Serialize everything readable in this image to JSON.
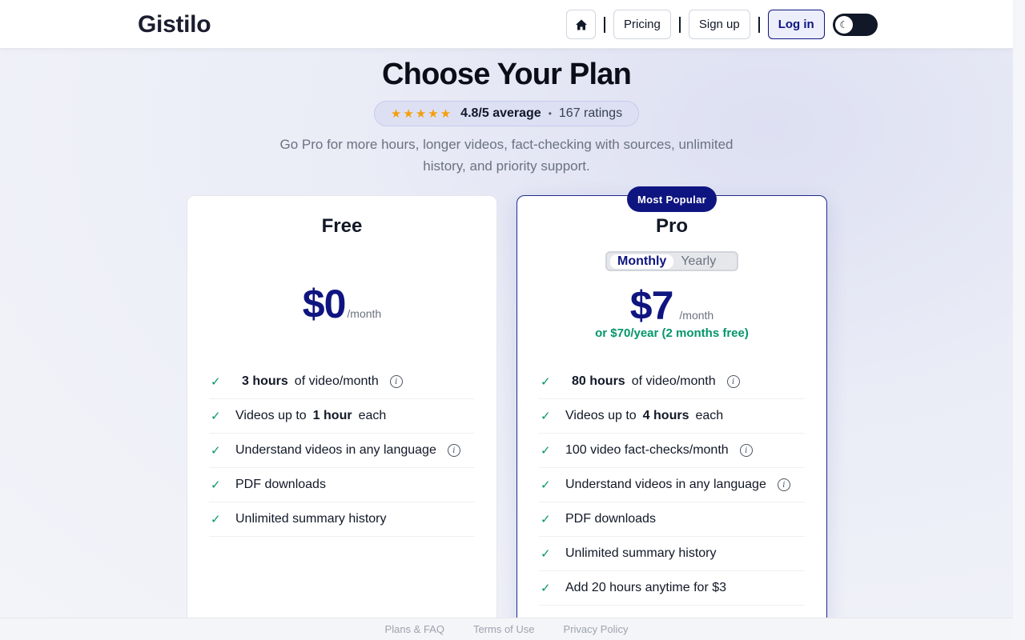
{
  "nav": {
    "logo": "Gistilo",
    "home_icon": "home-icon",
    "pricing_label": "Pricing",
    "signup_label": "Sign up",
    "login_label": "Log in",
    "theme_toggle_icon": "☾"
  },
  "hero": {
    "title": "Choose Your Plan",
    "stars": "★★★★★",
    "rating_text": "4.8/5 average",
    "separator": "•",
    "ratings_count": "167 ratings",
    "subtitle": "Go Pro for more hours, longer videos, fact-checking with sources, unlimited history, and priority support."
  },
  "plans": {
    "free": {
      "name": "Free",
      "price": "$0",
      "period": "/month",
      "features": [
        {
          "pre": "",
          "bold": "3 hours",
          "post": "of video/month",
          "info": true
        },
        {
          "pre": "Videos up to",
          "bold": "1 hour",
          "post": "each",
          "info": false
        },
        {
          "pre": "Understand videos in any language",
          "bold": "",
          "post": "",
          "info": true
        },
        {
          "pre": "PDF downloads",
          "bold": "",
          "post": "",
          "info": false
        },
        {
          "pre": "Unlimited summary history",
          "bold": "",
          "post": "",
          "info": false
        }
      ]
    },
    "pro": {
      "badge": "Most Popular",
      "name": "Pro",
      "billing_monthly": "Monthly",
      "billing_yearly": "Yearly",
      "price": "$7",
      "period": "/month",
      "yearly_note": "or $70/year (2 months free)",
      "features": [
        {
          "pre": "",
          "bold": "80 hours",
          "post": "of video/month",
          "info": true
        },
        {
          "pre": "Videos up to",
          "bold": "4 hours",
          "post": "each",
          "info": false
        },
        {
          "pre": "100 video fact-checks/month",
          "bold": "",
          "post": "",
          "info": true
        },
        {
          "pre": "Understand videos in any language",
          "bold": "",
          "post": "",
          "info": true
        },
        {
          "pre": "PDF downloads",
          "bold": "",
          "post": "",
          "info": false
        },
        {
          "pre": "Unlimited summary history",
          "bold": "",
          "post": "",
          "info": false
        },
        {
          "pre": "Add 20 hours anytime for $3",
          "bold": "",
          "post": "",
          "info": false
        }
      ]
    }
  },
  "footer": {
    "links": [
      "Plans & FAQ",
      "Terms of Use",
      "Privacy Policy"
    ]
  },
  "colors": {
    "brand": "#0f1580",
    "success": "#059669",
    "star": "#f59e0b"
  }
}
